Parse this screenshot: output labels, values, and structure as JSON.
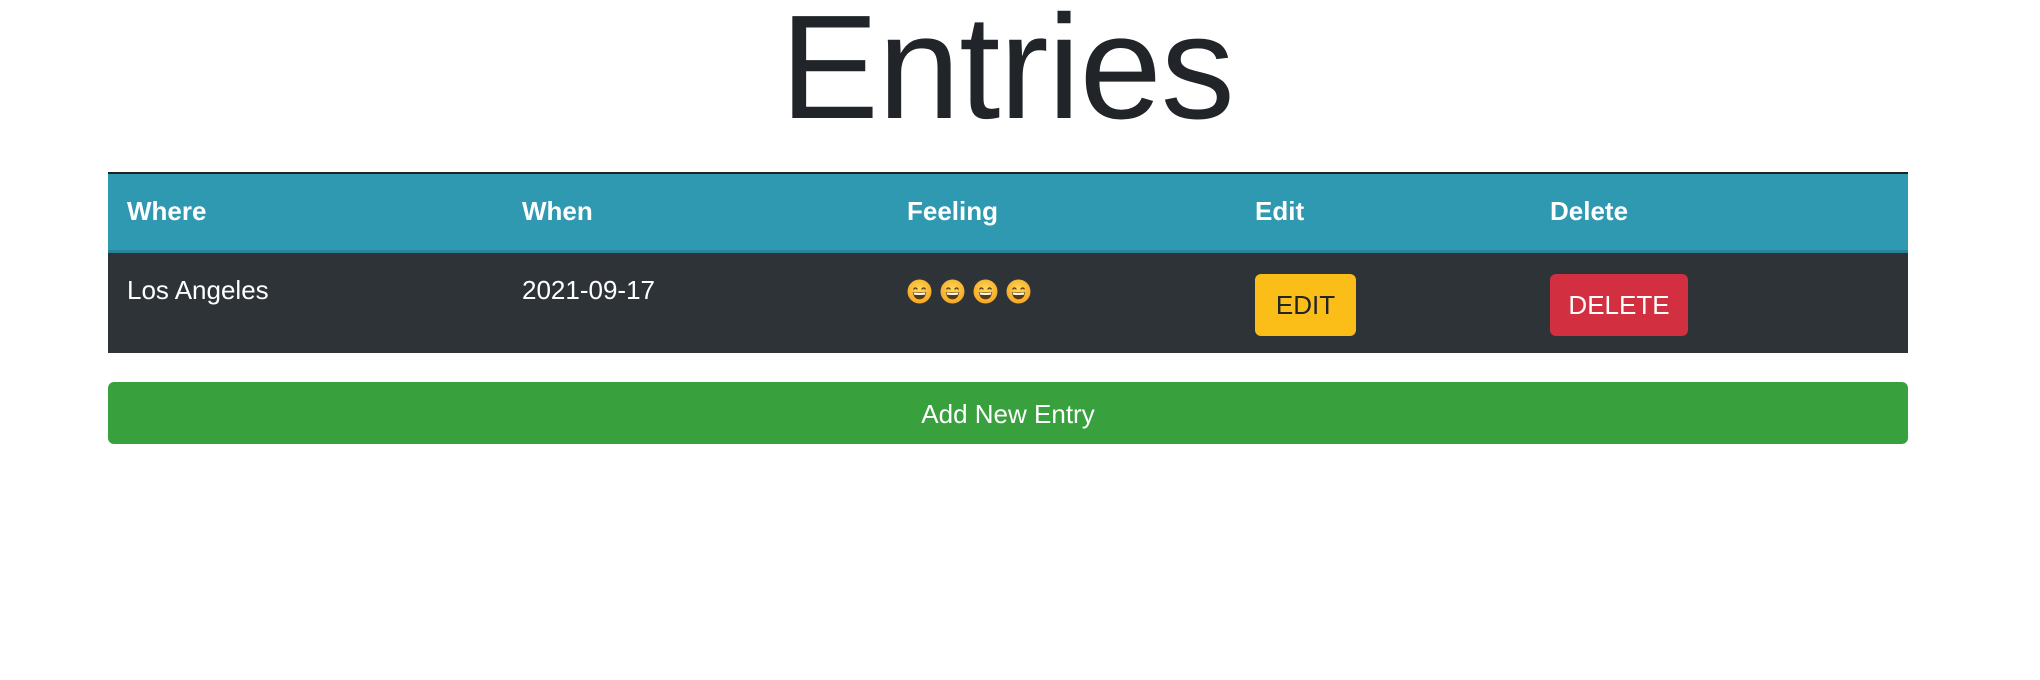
{
  "page": {
    "title": "Entries"
  },
  "table": {
    "headers": {
      "where": "Where",
      "when": "When",
      "feeling": "Feeling",
      "edit": "Edit",
      "delete": "Delete"
    },
    "rows": [
      {
        "where": "Los Angeles",
        "when": "2021-09-17",
        "feeling_icons": [
          "grinning-face-icon",
          "grinning-face-icon",
          "grinning-face-icon",
          "grinning-face-icon"
        ],
        "edit_label": "EDIT",
        "delete_label": "DELETE"
      }
    ]
  },
  "actions": {
    "add_label": "Add New Entry"
  },
  "colors": {
    "header_bg": "#2e99b0",
    "row_bg": "#2e3338",
    "edit_button": "#fbbd17",
    "delete_button": "#d22f40",
    "add_button": "#38a03d"
  }
}
